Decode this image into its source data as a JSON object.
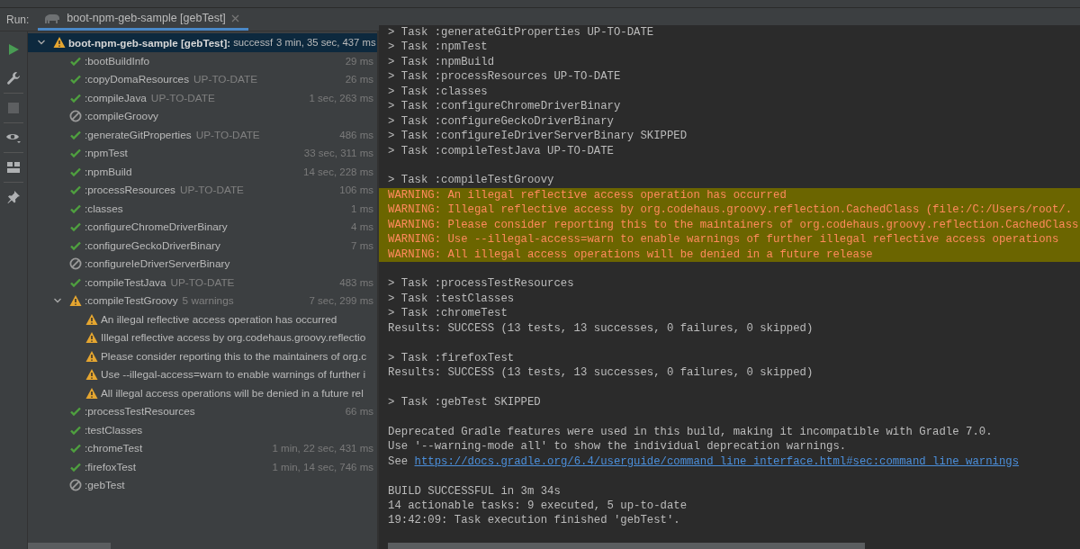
{
  "run_bar": {
    "label": "Run:",
    "tab": {
      "title": "boot-npm-geb-sample [gebTest]",
      "selected": true
    }
  },
  "tree": [
    {
      "kind": "warning",
      "name": "boot-npm-geb-sample [gebTest]:",
      "note": "successf",
      "time": "3 min, 35 sec, 437 ms",
      "selected": true,
      "expanded": true,
      "children": [
        {
          "kind": "success",
          "name": ":bootBuildInfo",
          "time": "29 ms",
          "selected": false
        },
        {
          "kind": "success",
          "name": ":copyDomaResources",
          "note": "UP-TO-DATE",
          "time": "26 ms",
          "selected": false
        },
        {
          "kind": "success",
          "name": ":compileJava",
          "note": "UP-TO-DATE",
          "time": "1 sec, 263 ms",
          "selected": false
        },
        {
          "kind": "skipped",
          "name": ":compileGroovy",
          "selected": false
        },
        {
          "kind": "success",
          "name": ":generateGitProperties",
          "note": "UP-TO-DATE",
          "time": "486 ms",
          "selected": false
        },
        {
          "kind": "success",
          "name": ":npmTest",
          "time": "33 sec, 311 ms",
          "selected": false
        },
        {
          "kind": "success",
          "name": ":npmBuild",
          "time": "14 sec, 228 ms",
          "selected": false
        },
        {
          "kind": "success",
          "name": ":processResources",
          "note": "UP-TO-DATE",
          "time": "106 ms",
          "selected": false
        },
        {
          "kind": "success",
          "name": ":classes",
          "time": "1 ms",
          "selected": false
        },
        {
          "kind": "success",
          "name": ":configureChromeDriverBinary",
          "time": "4 ms",
          "selected": false
        },
        {
          "kind": "success",
          "name": ":configureGeckoDriverBinary",
          "time": "7 ms",
          "selected": false
        },
        {
          "kind": "skipped",
          "name": ":configureIeDriverServerBinary",
          "selected": false
        },
        {
          "kind": "success",
          "name": ":compileTestJava",
          "note": "UP-TO-DATE",
          "time": "483 ms",
          "selected": false
        },
        {
          "kind": "warning",
          "name": ":compileTestGroovy",
          "note": "5 warnings",
          "time": "7 sec, 299 ms",
          "selected": false,
          "expanded": true,
          "children": [
            {
              "kind": "warning",
              "name": "An illegal reflective access operation has occurred",
              "selected": false
            },
            {
              "kind": "warning",
              "name": "Illegal reflective access by org.codehaus.groovy.reflectio",
              "selected": false
            },
            {
              "kind": "warning",
              "name": "Please consider reporting this to the maintainers of org.c",
              "selected": false
            },
            {
              "kind": "warning",
              "name": "Use --illegal-access=warn to enable warnings of further i",
              "selected": false
            },
            {
              "kind": "warning",
              "name": "All illegal access operations will be denied in a future rel",
              "selected": false
            }
          ]
        },
        {
          "kind": "success",
          "name": ":processTestResources",
          "time": "66 ms",
          "selected": false
        },
        {
          "kind": "success",
          "name": ":testClasses",
          "selected": false
        },
        {
          "kind": "success",
          "name": ":chromeTest",
          "time": "1 min, 22 sec, 431 ms",
          "selected": false
        },
        {
          "kind": "success",
          "name": ":firefoxTest",
          "time": "1 min, 14 sec, 746 ms",
          "selected": false
        },
        {
          "kind": "skipped",
          "name": ":gebTest",
          "selected": false
        }
      ]
    }
  ],
  "console": [
    {
      "kind": "text",
      "text": "> Task :generateGitProperties UP-TO-DATE"
    },
    {
      "kind": "text",
      "text": "> Task :npmTest"
    },
    {
      "kind": "text",
      "text": "> Task :npmBuild"
    },
    {
      "kind": "text",
      "text": "> Task :processResources UP-TO-DATE"
    },
    {
      "kind": "text",
      "text": "> Task :classes"
    },
    {
      "kind": "text",
      "text": "> Task :configureChromeDriverBinary"
    },
    {
      "kind": "text",
      "text": "> Task :configureGeckoDriverBinary"
    },
    {
      "kind": "text",
      "text": "> Task :configureIeDriverServerBinary SKIPPED"
    },
    {
      "kind": "text",
      "text": "> Task :compileTestJava UP-TO-DATE"
    },
    {
      "kind": "blank"
    },
    {
      "kind": "text",
      "text": "> Task :compileTestGroovy"
    },
    {
      "kind": "warning",
      "text": "WARNING: An illegal reflective access operation has occurred"
    },
    {
      "kind": "warning",
      "text": "WARNING: Illegal reflective access by org.codehaus.groovy.reflection.CachedClass (file:/C:/Users/root/."
    },
    {
      "kind": "warning",
      "text": "WARNING: Please consider reporting this to the maintainers of org.codehaus.groovy.reflection.CachedClass"
    },
    {
      "kind": "warning",
      "text": "WARNING: Use --illegal-access=warn to enable warnings of further illegal reflective access operations"
    },
    {
      "kind": "warning",
      "text": "WARNING: All illegal access operations will be denied in a future release"
    },
    {
      "kind": "blank"
    },
    {
      "kind": "text",
      "text": "> Task :processTestResources"
    },
    {
      "kind": "text",
      "text": "> Task :testClasses"
    },
    {
      "kind": "text",
      "text": "> Task :chromeTest"
    },
    {
      "kind": "text",
      "text": "Results: SUCCESS (13 tests, 13 successes, 0 failures, 0 skipped)"
    },
    {
      "kind": "blank"
    },
    {
      "kind": "text",
      "text": "> Task :firefoxTest"
    },
    {
      "kind": "text",
      "text": "Results: SUCCESS (13 tests, 13 successes, 0 failures, 0 skipped)"
    },
    {
      "kind": "blank"
    },
    {
      "kind": "text",
      "text": "> Task :gebTest SKIPPED"
    },
    {
      "kind": "blank"
    },
    {
      "kind": "text",
      "text": "Deprecated Gradle features were used in this build, making it incompatible with Gradle 7.0."
    },
    {
      "kind": "text",
      "text": "Use '--warning-mode all' to show the individual deprecation warnings."
    },
    {
      "kind": "link",
      "text": "See",
      "link": "https://docs.gradle.org/6.4/userguide/command_line_interface.html#sec:command_line_warnings"
    },
    {
      "kind": "blank"
    },
    {
      "kind": "text",
      "text": "BUILD SUCCESSFUL in 3m 34s"
    },
    {
      "kind": "text",
      "text": "14 actionable tasks: 9 executed, 5 up-to-date"
    },
    {
      "kind": "text",
      "text": "19:42:09: Task execution finished 'gebTest'."
    }
  ]
}
